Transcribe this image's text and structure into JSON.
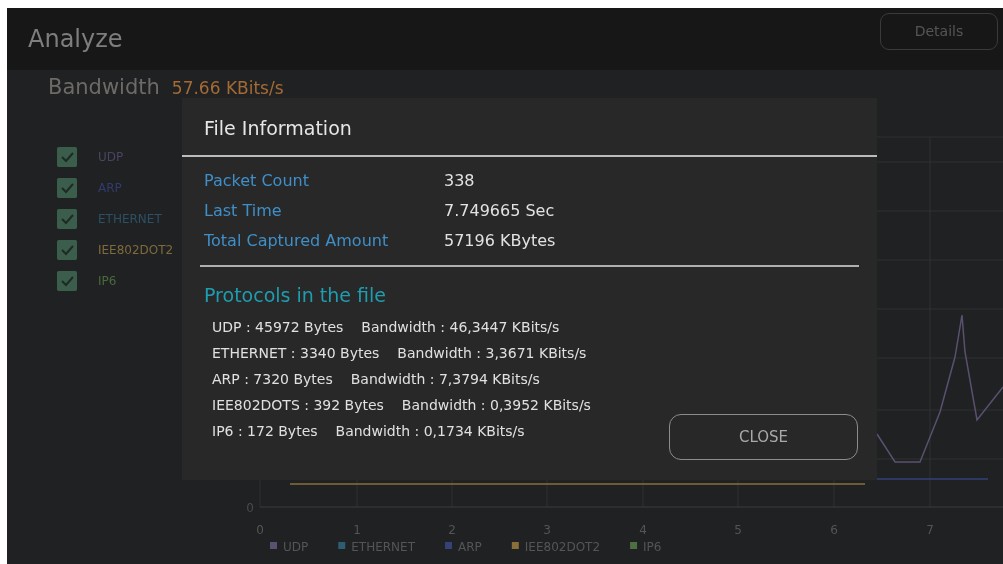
{
  "header": {
    "title": "Analyze",
    "details_button": "Details"
  },
  "bandwidth": {
    "label": "Bandwidth",
    "value": "57.66 KBits/s"
  },
  "protocol_filters": [
    {
      "label": "UDP",
      "checked": true,
      "color": "#4b4363"
    },
    {
      "label": "ARP",
      "checked": true,
      "color": "#323c6c"
    },
    {
      "label": "ETHERNET",
      "checked": true,
      "color": "#2c5064"
    },
    {
      "label": "IEE802DOT2",
      "checked": true,
      "color": "#7f6a3c"
    },
    {
      "label": "IP6",
      "checked": true,
      "color": "#4b6a3c"
    }
  ],
  "chart": {
    "y_tick_labels": [
      "0"
    ],
    "x_tick_labels": [
      "0",
      "1",
      "2",
      "3",
      "4",
      "5",
      "6",
      "7"
    ],
    "legend": [
      {
        "label": "UDP",
        "color": "#5a5070"
      },
      {
        "label": "ETHERNET",
        "color": "#2e5d73"
      },
      {
        "label": "ARP",
        "color": "#35427a"
      },
      {
        "label": "IEE802DOT2",
        "color": "#8a6e3a"
      },
      {
        "label": "IP6",
        "color": "#4e7040"
      }
    ]
  },
  "dialog": {
    "title": "File Information",
    "fields": [
      {
        "label": "Packet Count",
        "value": "338"
      },
      {
        "label": "Last Time",
        "value": "7.749665 Sec"
      },
      {
        "label": "Total Captured Amount",
        "value": "57196 KBytes"
      }
    ],
    "protocols_heading": "Protocols in the file",
    "protocols": [
      {
        "bytes": "UDP : 45972 Bytes",
        "bandwidth": "Bandwidth : 46,3447 KBits/s"
      },
      {
        "bytes": "ETHERNET : 3340 Bytes",
        "bandwidth": "Bandwidth : 3,3671 KBits/s"
      },
      {
        "bytes": "ARP : 7320 Bytes",
        "bandwidth": "Bandwidth : 7,3794 KBits/s"
      },
      {
        "bytes": "IEE802DOTS : 392 Bytes",
        "bandwidth": "Bandwidth : 0,3952 KBits/s"
      },
      {
        "bytes": "IP6 : 172 Bytes",
        "bandwidth": "Bandwidth : 0,1734 KBits/s"
      }
    ],
    "close_button": "CLOSE"
  }
}
